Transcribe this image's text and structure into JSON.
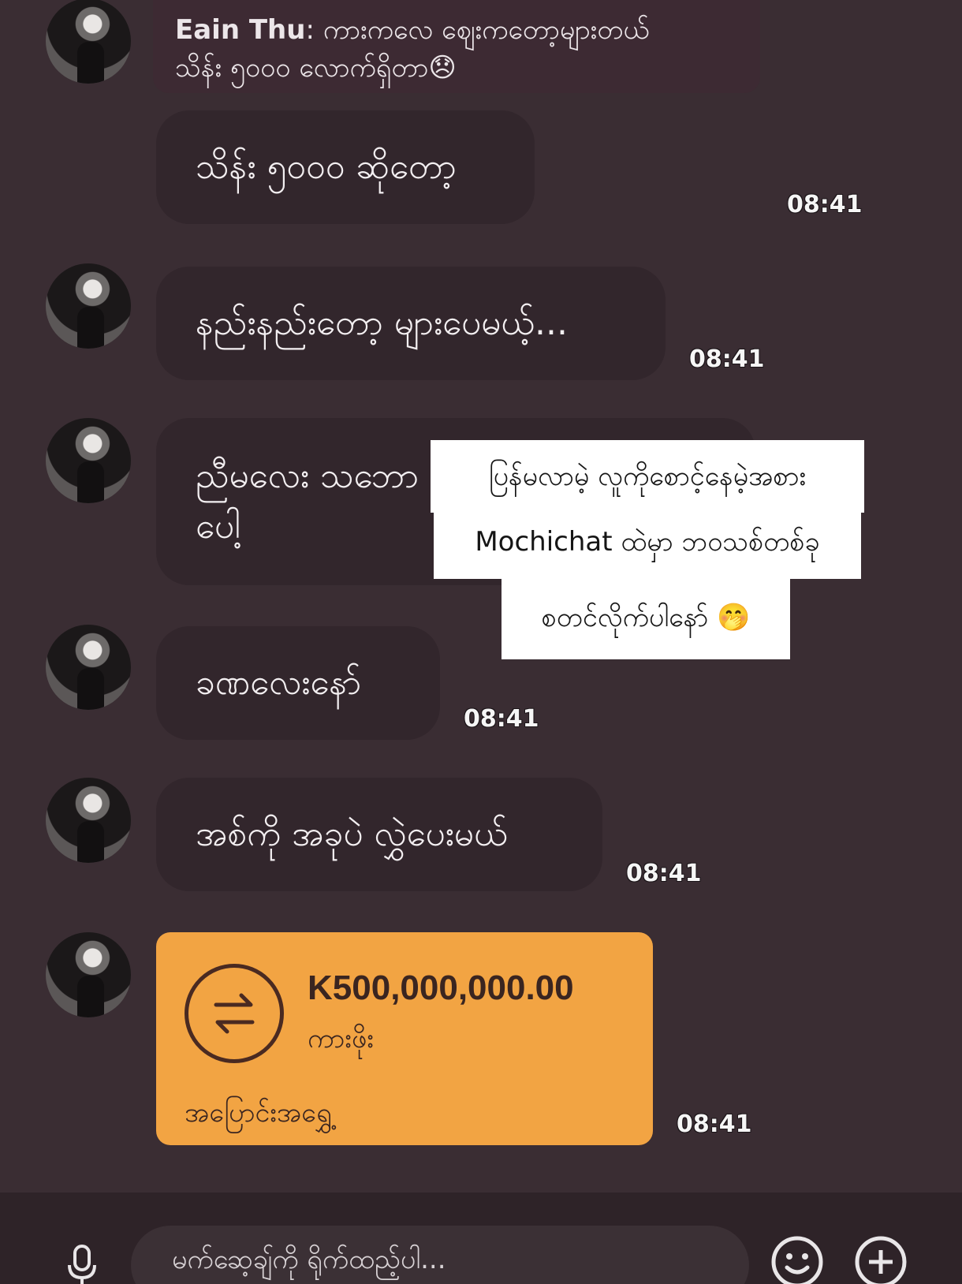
{
  "reply_preview": {
    "sender": "Eain Thu",
    "separator": ":",
    "text_line1": "ကားကလေ ဈေးကတော့များတယ်",
    "text_line2": "သိန်း ၅၀၀၀ လောက်ရှိတာ😞"
  },
  "messages": [
    {
      "text": "သိန်း ၅၀၀၀ ဆိုတော့",
      "time": "08:41"
    },
    {
      "text": "နည်းနည်းတော့ များပေမယ့်...",
      "time": "08:41"
    },
    {
      "text_line1": "ညီမလေး သဘော",
      "text_line2": "ပေါ့"
    },
    {
      "text": "ခဏလေးနော်",
      "time": "08:41"
    },
    {
      "text": "အစ်ကို အခုပဲ လွှဲပေးမယ်",
      "time": "08:41"
    }
  ],
  "transfer": {
    "amount": "K500,000,000.00",
    "subtitle": "ကားဖိုး",
    "label": "အပြောင်းအရွှေ့",
    "time": "08:41",
    "color": "#f2a443"
  },
  "overlay_caption": {
    "line1": "ပြန်မလာမဲ့ လူကိုစောင့်နေမဲ့အစား",
    "line2": "Mochichat ထဲမှာ ဘဝသစ်တစ်ခု",
    "line3": "စတင်လိုက်ပါနော် 🤭"
  },
  "composer": {
    "placeholder": "မက်ဆေ့ချ်ကို ရိုက်ထည့်ပါ...",
    "mic_icon": "microphone-icon",
    "emoji_icon": "smiley-icon",
    "add_icon": "plus-circle-icon"
  }
}
